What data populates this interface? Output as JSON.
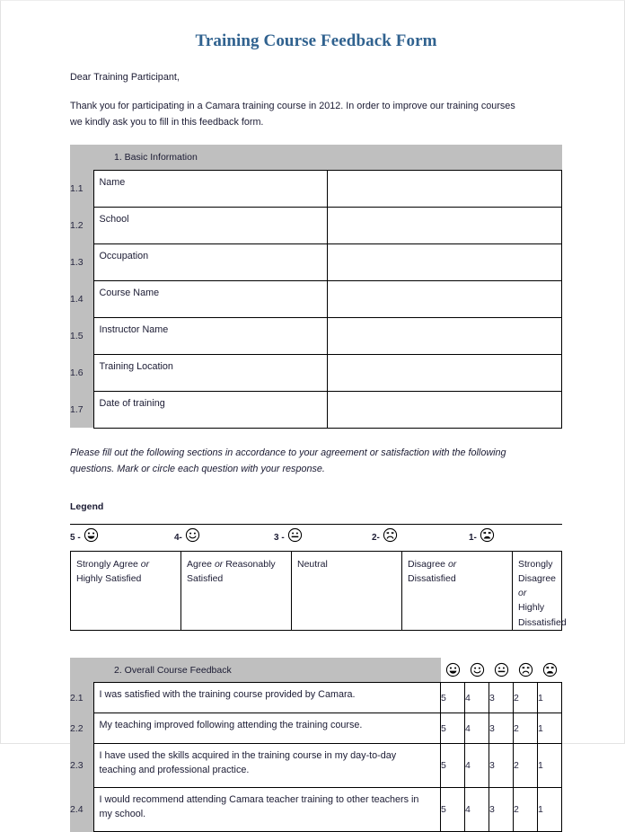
{
  "document": {
    "title": "Training Course Feedback Form",
    "salutation": "Dear Training Participant,",
    "intro_paragraph": "Thank you for participating in a Camara training course in 2012. In order to improve our training courses we kindly ask you to fill in this feedback form.",
    "instruction_line_1": "Please fill out the following sections in accordance to your agreement or satisfaction with the following questions.",
    "instruction_line_2": "Mark or circle each question with your response."
  },
  "colors": {
    "title_blue": "#30628f",
    "header_grey": "#bfbfbf",
    "text": "#1b1b33",
    "border": "#000000",
    "page_border": "#e3e3e3"
  },
  "section_basic": {
    "heading": "1. Basic Information",
    "rows": [
      {
        "num": "1.1",
        "label": "Name",
        "value": ""
      },
      {
        "num": "1.2",
        "label": "School",
        "value": ""
      },
      {
        "num": "1.3",
        "label": "Occupation",
        "value": ""
      },
      {
        "num": "1.4",
        "label": "Course Name",
        "value": ""
      },
      {
        "num": "1.5",
        "label": "Instructor Name",
        "value": ""
      },
      {
        "num": "1.6",
        "label": "Training Location",
        "value": ""
      },
      {
        "num": "1.7",
        "label": "Date of training",
        "value": ""
      }
    ]
  },
  "legend": {
    "heading": "Legend",
    "scale": [
      {
        "num": "5 -",
        "icon": "face-very-happy-icon",
        "label_pre": "Strongly Agree ",
        "label_em": "or",
        "label_post": " Highly Satisfied"
      },
      {
        "num": "4-",
        "icon": "face-happy-icon",
        "label_pre": "Agree ",
        "label_em": "or",
        "label_post": " Reasonably Satisfied"
      },
      {
        "num": "3 -",
        "icon": "face-neutral-icon",
        "label_pre": "Neutral",
        "label_em": "",
        "label_post": ""
      },
      {
        "num": "2-",
        "icon": "face-sad-icon",
        "label_pre": "Disagree ",
        "label_em": "or",
        "label_post": " Dissatisfied"
      },
      {
        "num": "1-",
        "icon": "face-very-sad-icon",
        "label_pre": "Strongly Disagree ",
        "label_em": "or",
        "label_post": " Highly Dissatisfied"
      }
    ]
  },
  "section_feedback": {
    "heading": "2. Overall Course Feedback",
    "rating_icons": [
      "face-very-happy-icon",
      "face-happy-icon",
      "face-neutral-icon",
      "face-sad-icon",
      "face-very-sad-icon"
    ],
    "scores": [
      "5",
      "4",
      "3",
      "2",
      "1"
    ],
    "rows": [
      {
        "num": "2.1",
        "question": "I was satisfied with the training course provided by Camara.",
        "scores": [
          "5",
          "4",
          "3",
          "2",
          "1"
        ]
      },
      {
        "num": "2.2",
        "question": "My teaching improved following attending the training course.",
        "scores": [
          "5",
          "4",
          "3",
          "2",
          "1"
        ]
      },
      {
        "num": "2.3",
        "question": "I have used the skills acquired in the training course in my day-to-day teaching and professional practice.",
        "scores": [
          "5",
          "4",
          "3",
          "2",
          "1"
        ]
      },
      {
        "num": "2.4",
        "question": "I would recommend attending Camara teacher training to other teachers in my school.",
        "scores": [
          "5",
          "4",
          "3",
          "2",
          "1"
        ]
      }
    ]
  }
}
